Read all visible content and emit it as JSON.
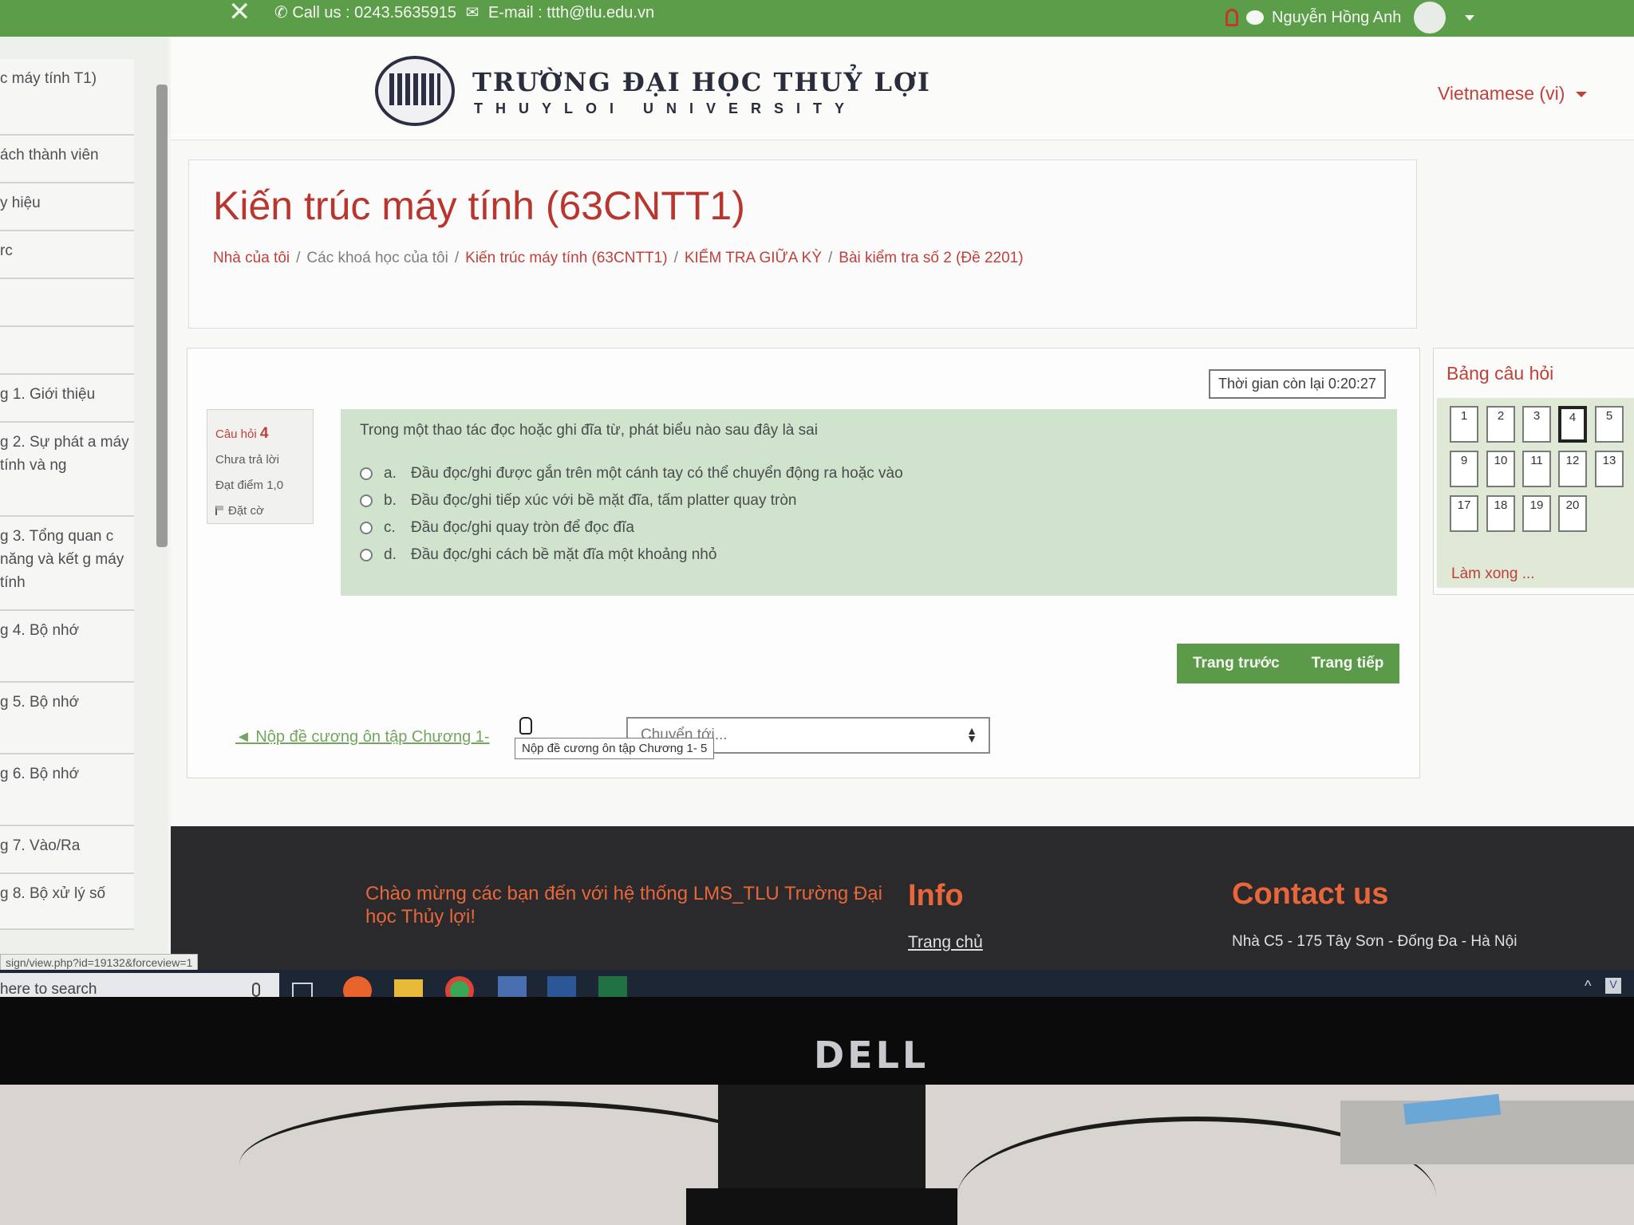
{
  "topbar": {
    "phone": "Call us : 0243.5635915",
    "email": "E-mail : ttth@tlu.edu.vn",
    "user_name": "Nguyễn Hồng Anh"
  },
  "sidebar": {
    "items": [
      {
        "label": "c máy tính T1)"
      },
      {
        "label": "ách thành viên"
      },
      {
        "label": "y hiệu"
      },
      {
        "label": "rc"
      },
      {
        "label": ""
      },
      {
        "label": ""
      },
      {
        "label": "g 1. Giới thiệu"
      },
      {
        "label": "g 2. Sự phát a máy tính và ng"
      },
      {
        "label": "g 3. Tổng quan c năng và kết g máy tính"
      },
      {
        "label": "g 4. Bộ nhớ"
      },
      {
        "label": "g 5. Bộ nhớ"
      },
      {
        "label": "g 6. Bộ nhớ"
      },
      {
        "label": "g 7. Vào/Ra"
      },
      {
        "label": "g 8. Bộ xử lý số"
      }
    ]
  },
  "header": {
    "logo_title": "TRƯỜNG ĐẠI HỌC THUỶ LỢI",
    "logo_subtitle": "THUYLOI UNIVERSITY",
    "language": "Vietnamese (vi)"
  },
  "course": {
    "title": "Kiến trúc máy tính (63CNTT1)",
    "breadcrumb": [
      "Nhà của tôi",
      "Các khoá học của tôi",
      "Kiến trúc máy tính (63CNTT1)",
      "KIỂM TRA GIỮA KỲ",
      "Bài kiểm tra số 2 (Đề 2201)"
    ]
  },
  "quiz": {
    "timer": "Thời gian còn lại 0:20:27",
    "question_label": "Câu hỏi",
    "question_number": "4",
    "status": "Chưa trả lời",
    "points": "Đạt điểm 1,0",
    "flag": "Đặt cờ",
    "prompt": "Trong một thao tác đọc hoặc ghi đĩa từ, phát biểu nào sau đây là sai",
    "options": [
      {
        "letter": "a.",
        "text": "Đầu đọc/ghi được gắn trên một cánh tay có thể chuyển động ra hoặc vào"
      },
      {
        "letter": "b.",
        "text": "Đầu đọc/ghi tiếp xúc với bề mặt đĩa, tấm platter quay tròn"
      },
      {
        "letter": "c.",
        "text": "Đầu đọc/ghi quay tròn để đọc đĩa"
      },
      {
        "letter": "d.",
        "text": "Đầu đọc/ghi cách bề mặt đĩa một khoảng nhỏ"
      }
    ],
    "prev_button": "Trang trước",
    "next_button": "Trang tiếp",
    "prev_activity_link": "◄ Nộp đề cương ôn tập Chương 1-",
    "tooltip": "Nộp đề cương ôn tập Chương 1- 5",
    "jump_placeholder": "Chuyển tới..."
  },
  "question_nav": {
    "title": "Bảng câu hỏi",
    "numbers": [
      "1",
      "2",
      "3",
      "4",
      "5",
      "9",
      "10",
      "11",
      "12",
      "13",
      "17",
      "18",
      "19",
      "20"
    ],
    "current": "4",
    "finish": "Làm xong ..."
  },
  "footer": {
    "welcome": "Chào mừng các bạn đến với hệ thống LMS_TLU Trường Đại học Thủy lợi!",
    "info_title": "Info",
    "home_link": "Trang chủ",
    "contact_title": "Contact us",
    "address": "Nhà C5 - 175 Tây Sơn - Đống Đa - Hà Nội"
  },
  "status_url": "sign/view.php?id=19132&forceview=1",
  "taskbar": {
    "search_placeholder": "here to search"
  },
  "monitor": {
    "brand": "DELL"
  },
  "colors": {
    "topbar_green": "#5c9d4a",
    "accent_red": "#c0403a",
    "question_bg": "#cfe3cd",
    "footer_orange": "#e8663a"
  }
}
